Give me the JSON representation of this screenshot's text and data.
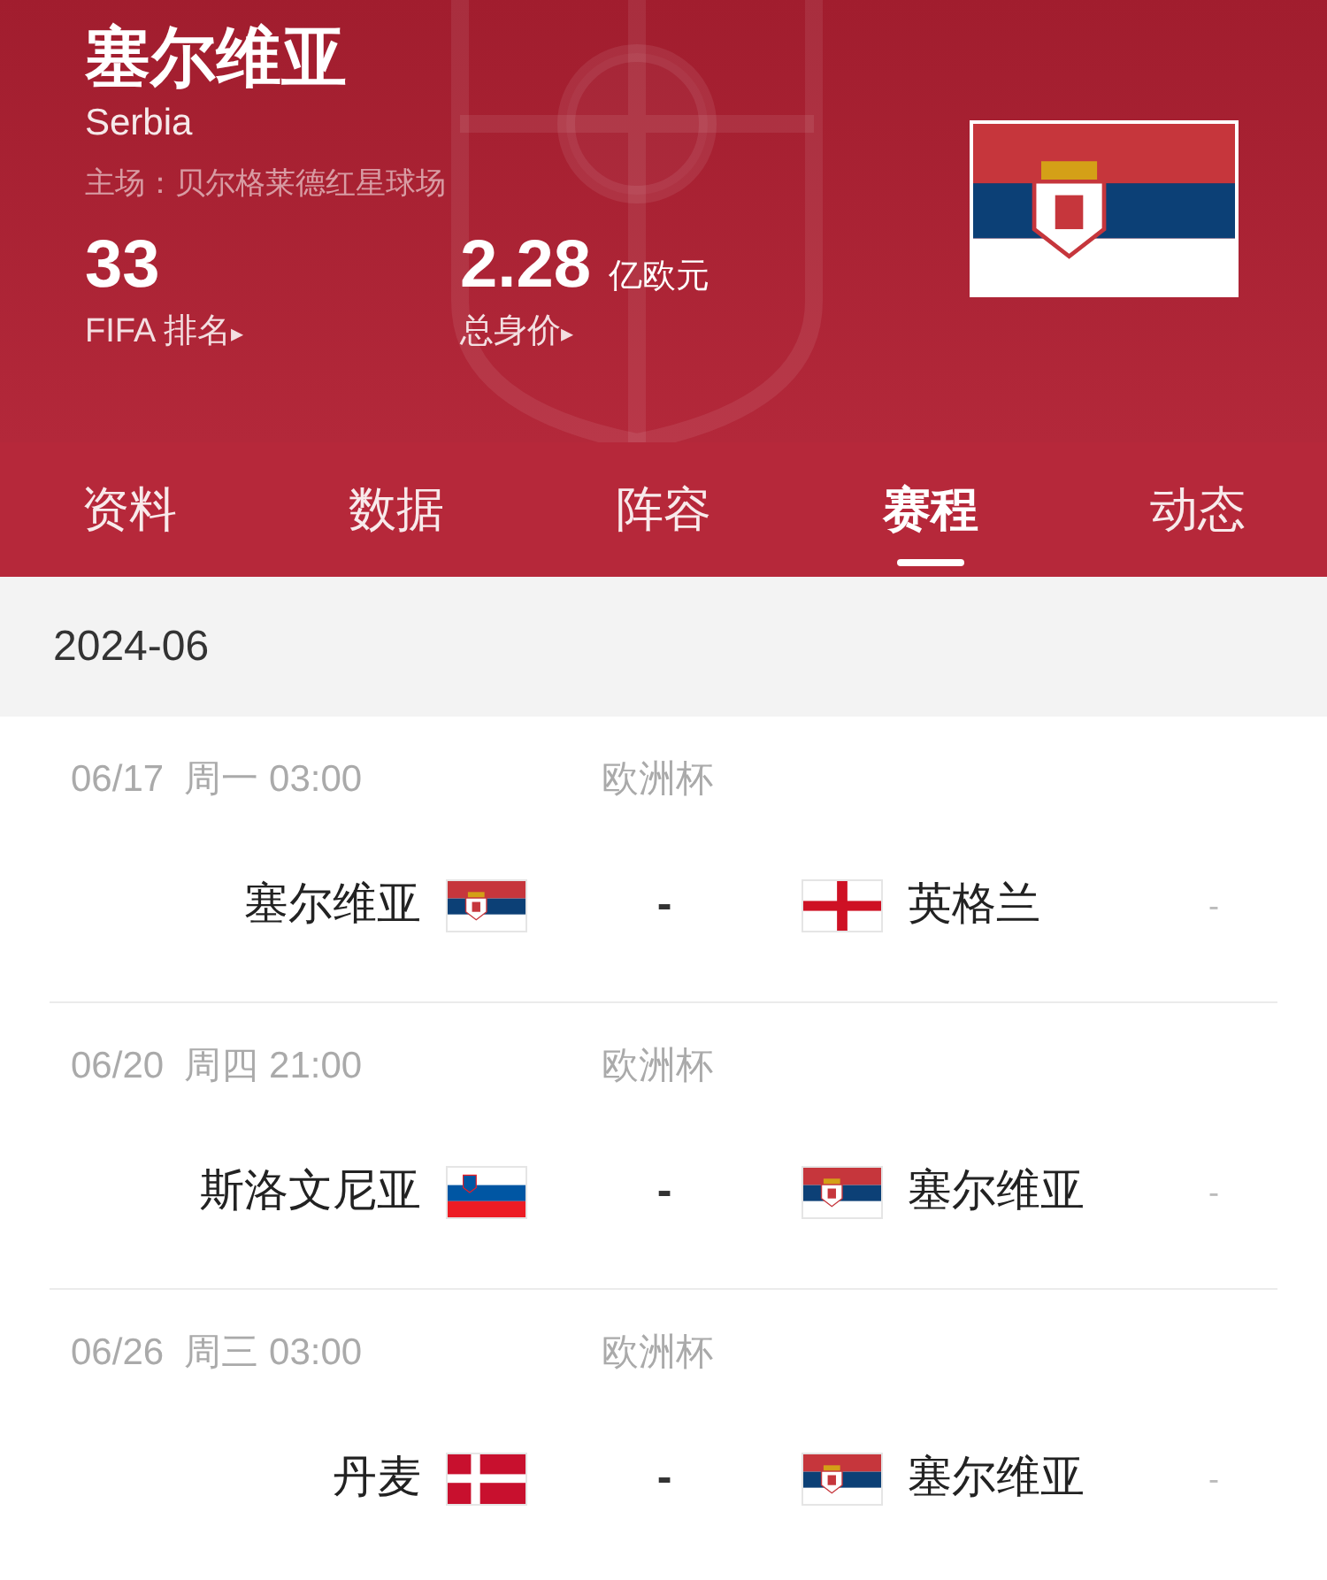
{
  "team": {
    "name": "塞尔维亚",
    "name_en": "Serbia",
    "stadium": "主场：贝尔格莱德红星球场",
    "kind": "serbia"
  },
  "stats": [
    {
      "value": "33",
      "label": "FIFA 排名",
      "arrow": "▸"
    },
    {
      "value": "2.28",
      "unit": "亿欧元",
      "label": "总身价",
      "arrow": "▸"
    }
  ],
  "tabs": [
    {
      "label": "资料",
      "selected": false
    },
    {
      "label": "数据",
      "selected": false
    },
    {
      "label": "阵容",
      "selected": false
    },
    {
      "label": "赛程",
      "selected": true
    },
    {
      "label": "动态",
      "selected": false
    }
  ],
  "month": "2024-06",
  "matches": [
    {
      "date": "06/17",
      "weekday": "周一",
      "time": "03:00",
      "competition": "欧洲杯",
      "home": {
        "name": "塞尔维亚",
        "kind": "serbia"
      },
      "score": "-",
      "away": {
        "name": "英格兰",
        "kind": "england"
      },
      "result": "-"
    },
    {
      "date": "06/20",
      "weekday": "周四",
      "time": "21:00",
      "competition": "欧洲杯",
      "home": {
        "name": "斯洛文尼亚",
        "kind": "slovenia"
      },
      "score": "-",
      "away": {
        "name": "塞尔维亚",
        "kind": "serbia"
      },
      "result": "-"
    },
    {
      "date": "06/26",
      "weekday": "周三",
      "time": "03:00",
      "competition": "欧洲杯",
      "home": {
        "name": "丹麦",
        "kind": "denmark"
      },
      "score": "-",
      "away": {
        "name": "塞尔维亚",
        "kind": "serbia"
      },
      "result": "-"
    }
  ]
}
